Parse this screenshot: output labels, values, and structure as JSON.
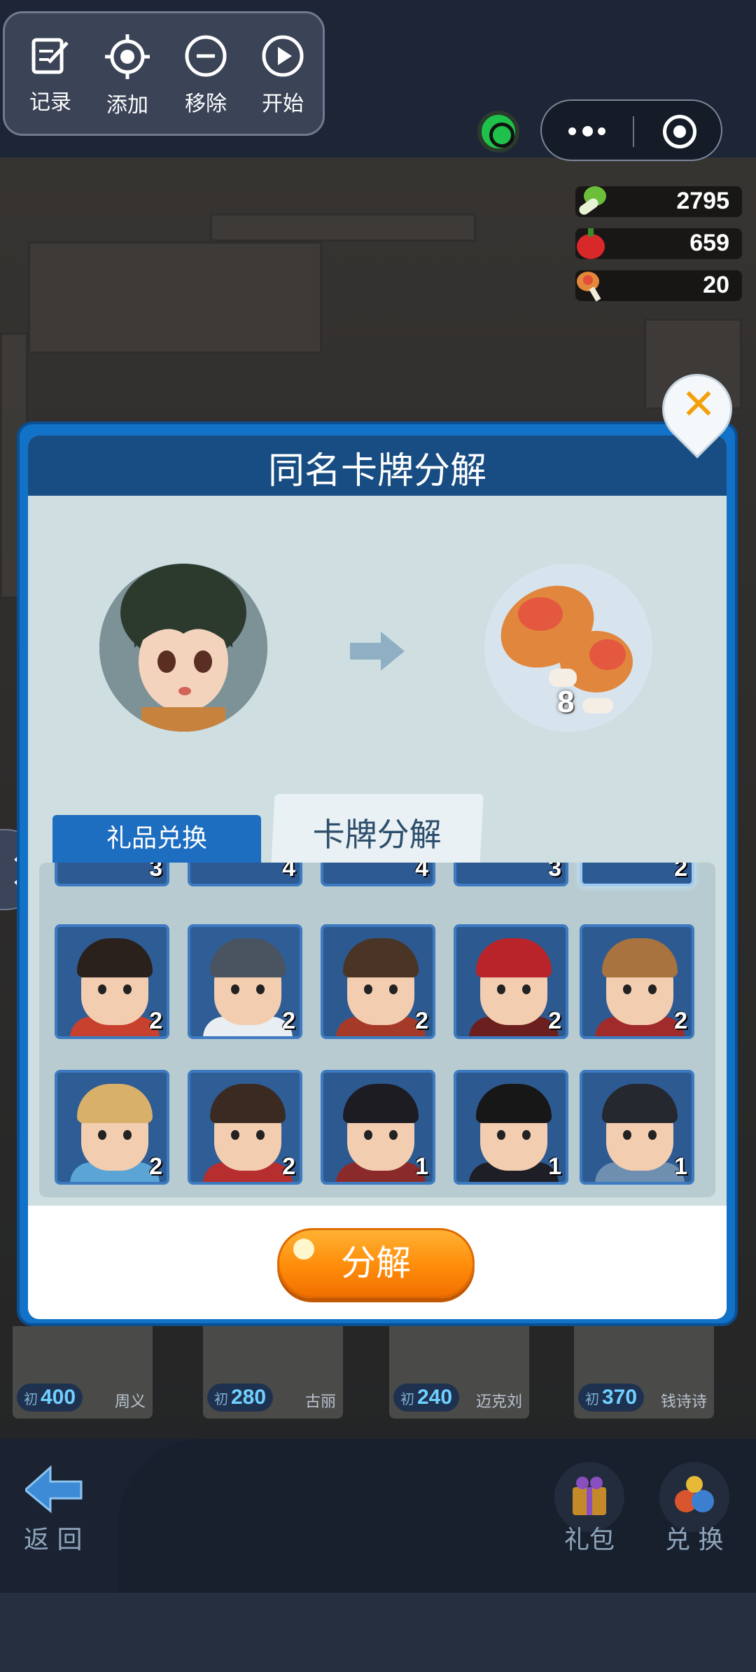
{
  "toolbar": {
    "record": "记录",
    "add": "添加",
    "remove": "移除",
    "start": "开始"
  },
  "resources": {
    "vegetable": "2795",
    "pepper": "659",
    "drumstick": "20"
  },
  "modal": {
    "title": "同名卡牌分解",
    "reward_count": "8",
    "tab_gift": "礼品兑换",
    "tab_decompose": "卡牌分解",
    "decompose_button": "分解"
  },
  "cards_top_counts": [
    "3",
    "4",
    "4",
    "3",
    "2"
  ],
  "cards": [
    {
      "count": "2",
      "bg": "#2e5c94",
      "hair": "#2a211d",
      "body": "#c8402e"
    },
    {
      "count": "2",
      "bg": "#2f5d95",
      "hair": "#4a5360",
      "body": "#e8eef2"
    },
    {
      "count": "2",
      "bg": "#2c5990",
      "hair": "#4a3425",
      "body": "#a63a28"
    },
    {
      "count": "2",
      "bg": "#2c5990",
      "hair": "#b8242a",
      "body": "#6b1f1f"
    },
    {
      "count": "2",
      "bg": "#2e5a92",
      "hair": "#a8733e",
      "body": "#a12a2a"
    },
    {
      "count": "2",
      "bg": "#2e5c94",
      "hair": "#d9b06a",
      "body": "#5aa4d6"
    },
    {
      "count": "2",
      "bg": "#2f5d95",
      "hair": "#3a2a22",
      "body": "#b62e2e"
    },
    {
      "count": "1",
      "bg": "#2c5990",
      "hair": "#1c1c22",
      "body": "#8a2a2a"
    },
    {
      "count": "1",
      "bg": "#2c5990",
      "hair": "#171717",
      "body": "#1e1e26"
    },
    {
      "count": "1",
      "bg": "#2e5a92",
      "hair": "#25282e",
      "body": "#6f8fb0"
    }
  ],
  "background_cards": [
    {
      "prefix": "初",
      "value": "400",
      "name": "周义"
    },
    {
      "prefix": "初",
      "value": "280",
      "name": "古丽"
    },
    {
      "prefix": "初",
      "value": "240",
      "name": "迈克刘"
    },
    {
      "prefix": "初",
      "value": "370",
      "name": "钱诗诗"
    }
  ],
  "bottom_nav": {
    "back": "返 回",
    "gift_pack": "礼包",
    "exchange": "兑 换"
  }
}
